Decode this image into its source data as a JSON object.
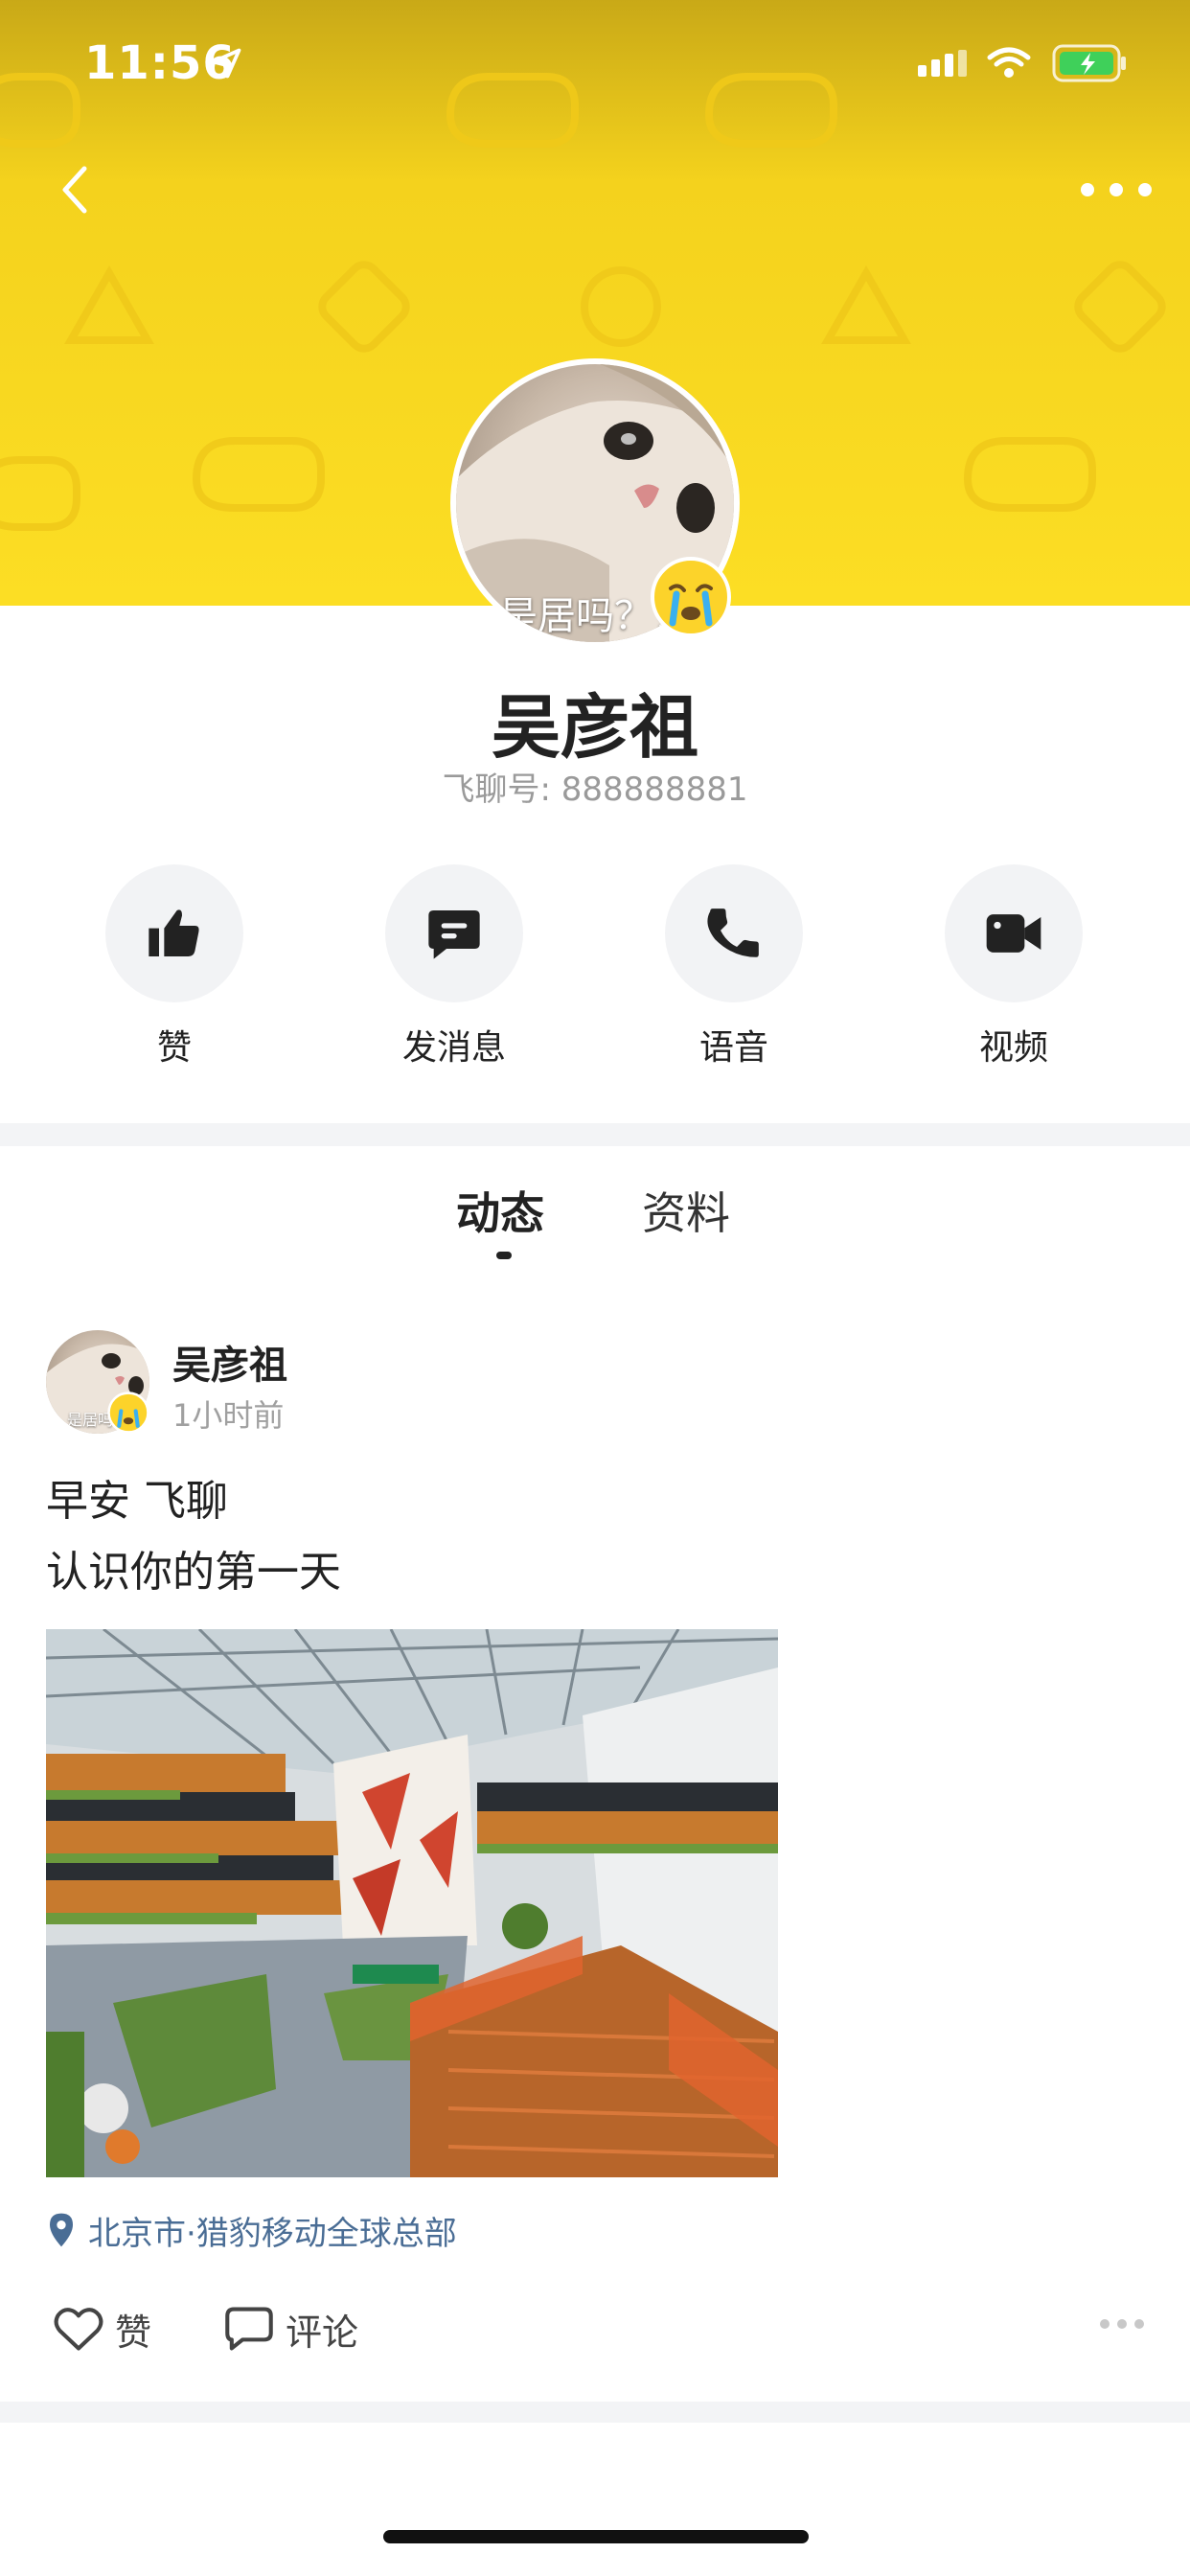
{
  "status_bar": {
    "time": "11:56"
  },
  "profile": {
    "avatar_caption": "是居吗？？",
    "name": "吴彦祖",
    "id_label": "飞聊号: 888888881"
  },
  "actions": [
    {
      "label": "赞",
      "icon": "thumbs-up-icon"
    },
    {
      "label": "发消息",
      "icon": "message-icon"
    },
    {
      "label": "语音",
      "icon": "phone-icon"
    },
    {
      "label": "视频",
      "icon": "video-camera-icon"
    }
  ],
  "tabs": [
    {
      "label": "动态",
      "active": true
    },
    {
      "label": "资料",
      "active": false
    }
  ],
  "post": {
    "author": "吴彦祖",
    "time": "1小时前",
    "avatar_caption": "是居吗？",
    "text_lines": [
      "早安 飞聊",
      "认识你的第一天"
    ],
    "location": "北京市·猎豹移动全球总部",
    "like_label": "赞",
    "comment_label": "评论"
  },
  "colors": {
    "header_yellow": "#fcde24",
    "location_blue": "#4a6d95",
    "action_bg": "#f2f3f5"
  }
}
